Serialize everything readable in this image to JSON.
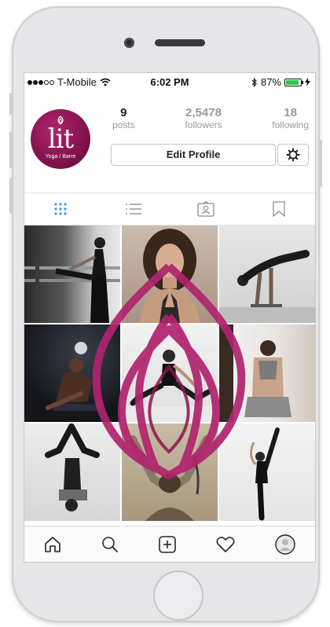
{
  "status_bar": {
    "carrier": "T-Mobile",
    "time": "6:02 PM",
    "battery": "87%",
    "battery_level": 0.87
  },
  "profile": {
    "avatar_logo_text": "lit",
    "avatar_sub_text": "Yoga / Barre",
    "stats": [
      {
        "value": "9",
        "label": "posts"
      },
      {
        "value": "2,5478",
        "label": "followers"
      },
      {
        "value": "18",
        "label": "following"
      }
    ],
    "edit_button_label": "Edit Profile"
  },
  "tabs": [
    {
      "icon": "grid-icon",
      "active": true
    },
    {
      "icon": "list-icon",
      "active": false
    },
    {
      "icon": "tagged-icon",
      "active": false
    },
    {
      "icon": "bookmark-icon",
      "active": false
    }
  ],
  "posts": [
    {
      "subject": "barre stretch at bar"
    },
    {
      "subject": "woman in prayer pose"
    },
    {
      "subject": "arm balance pose"
    },
    {
      "subject": "seated twist in dark light"
    },
    {
      "subject": "seated leg stretch"
    },
    {
      "subject": "reverse prayer from behind"
    },
    {
      "subject": "shoulder stand legs folded"
    },
    {
      "subject": "man forehead to floor"
    },
    {
      "subject": "standing leg extension"
    }
  ],
  "bottom_nav": [
    {
      "icon": "home-icon"
    },
    {
      "icon": "search-icon"
    },
    {
      "icon": "add-post-icon"
    },
    {
      "icon": "heart-icon"
    },
    {
      "icon": "profile-icon"
    }
  ],
  "colors": {
    "brand_magenta": "#b0246e",
    "tab_active": "#3897f0",
    "battery_green": "#2fc94a"
  }
}
